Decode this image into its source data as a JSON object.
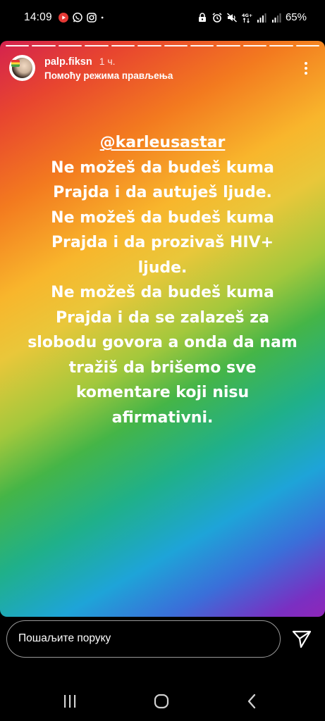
{
  "status_bar": {
    "time": "14:09",
    "left_icons": [
      "youtube-icon",
      "whatsapp-icon",
      "instagram-icon",
      "dot-icon"
    ],
    "right_icons": [
      "alarm-lock-icon",
      "alarm-icon",
      "mute-icon",
      "network-4g-icon",
      "signal-icon",
      "signal-icon-2"
    ],
    "battery": "65%"
  },
  "story": {
    "progress_segments": 12,
    "username": "palp.fiksn",
    "timestamp": "1 ч.",
    "subtitle": "Помоћу режима прављења",
    "text_lines": [
      "@karleusastar",
      "Ne možeš da budeš kuma",
      "Prajda i da autuješ ljude.",
      "Ne možeš da budeš kuma",
      "Prajda i da prozivaš HIV+",
      "ljude.",
      "Ne možeš da budeš kuma",
      "Prajda i da se zalazeš za",
      "slobodu govora a onda da nam",
      "tražiš da brišemo sve",
      "komentare koji nisu",
      "afirmativni."
    ]
  },
  "reply": {
    "placeholder": "Пошаљите поруку"
  },
  "nav": {
    "buttons": [
      "recent-apps-icon",
      "home-icon",
      "back-icon"
    ]
  }
}
